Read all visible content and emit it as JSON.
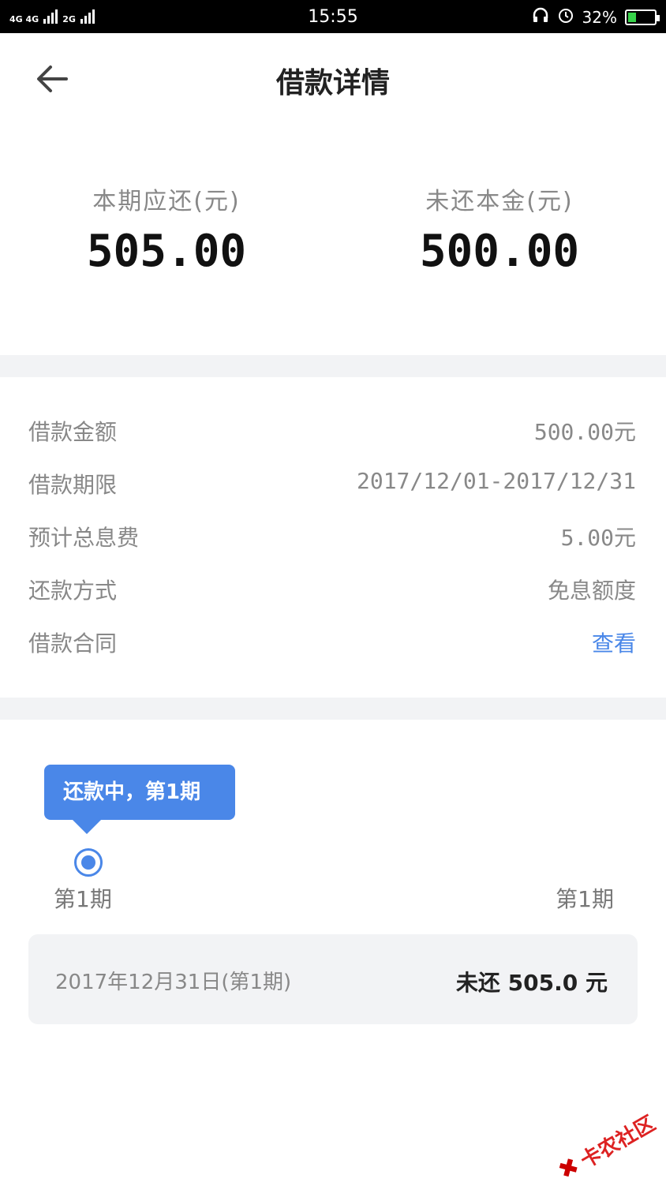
{
  "status_bar": {
    "network_left": "4G 4G",
    "network_right": "2G",
    "time": "15:55",
    "battery": "32%",
    "battery_level": 0.32
  },
  "header": {
    "title": "借款详情"
  },
  "summary": {
    "current_due_label": "本期应还(元)",
    "current_due_value": "505.00",
    "unpaid_principal_label": "未还本金(元)",
    "unpaid_principal_value": "500.00"
  },
  "details": [
    {
      "label": "借款金额",
      "value": "500.00元"
    },
    {
      "label": "借款期限",
      "value": "2017/12/01-2017/12/31"
    },
    {
      "label": "预计总息费",
      "value": "5.00元"
    },
    {
      "label": "还款方式",
      "value": "免息额度"
    },
    {
      "label": "借款合同",
      "value": "查看"
    }
  ],
  "timeline": {
    "tooltip": "还款中，第1期",
    "period_start": "第1期",
    "period_end": "第1期"
  },
  "installment": {
    "date": "2017年12月31日(第1期)",
    "status": "未还 505.0 元"
  },
  "watermark": "卡农社区",
  "colors": {
    "accent": "#4a87e8",
    "gap": "#f2f3f5"
  }
}
